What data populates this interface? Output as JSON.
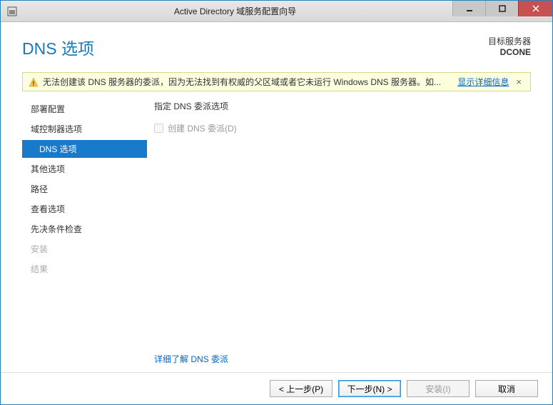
{
  "window": {
    "title": "Active Directory 域服务配置向导"
  },
  "header": {
    "page_title": "DNS 选项",
    "target_label": "目标服务器",
    "target_name": "DCONE"
  },
  "warning": {
    "text": "无法创建该 DNS 服务器的委派，因为无法找到有权威的父区域或者它未运行 Windows DNS 服务器。如...",
    "link": "显示详细信息",
    "close": "×"
  },
  "sidebar": {
    "items": [
      {
        "label": "部署配置",
        "indent": false,
        "selected": false,
        "disabled": false
      },
      {
        "label": "域控制器选项",
        "indent": false,
        "selected": false,
        "disabled": false
      },
      {
        "label": "DNS 选项",
        "indent": true,
        "selected": true,
        "disabled": false
      },
      {
        "label": "其他选项",
        "indent": false,
        "selected": false,
        "disabled": false
      },
      {
        "label": "路径",
        "indent": false,
        "selected": false,
        "disabled": false
      },
      {
        "label": "查看选项",
        "indent": false,
        "selected": false,
        "disabled": false
      },
      {
        "label": "先决条件检查",
        "indent": false,
        "selected": false,
        "disabled": false
      },
      {
        "label": "安装",
        "indent": false,
        "selected": false,
        "disabled": true
      },
      {
        "label": "结果",
        "indent": false,
        "selected": false,
        "disabled": true
      }
    ]
  },
  "main": {
    "section_label": "指定 DNS 委派选项",
    "checkbox_label": "创建 DNS 委派(D)",
    "checkbox_checked": false,
    "checkbox_enabled": false,
    "more_link": "详细了解 DNS 委派"
  },
  "footer": {
    "prev": "< 上一步(P)",
    "next": "下一步(N) >",
    "install": "安装(I)",
    "cancel": "取消"
  }
}
